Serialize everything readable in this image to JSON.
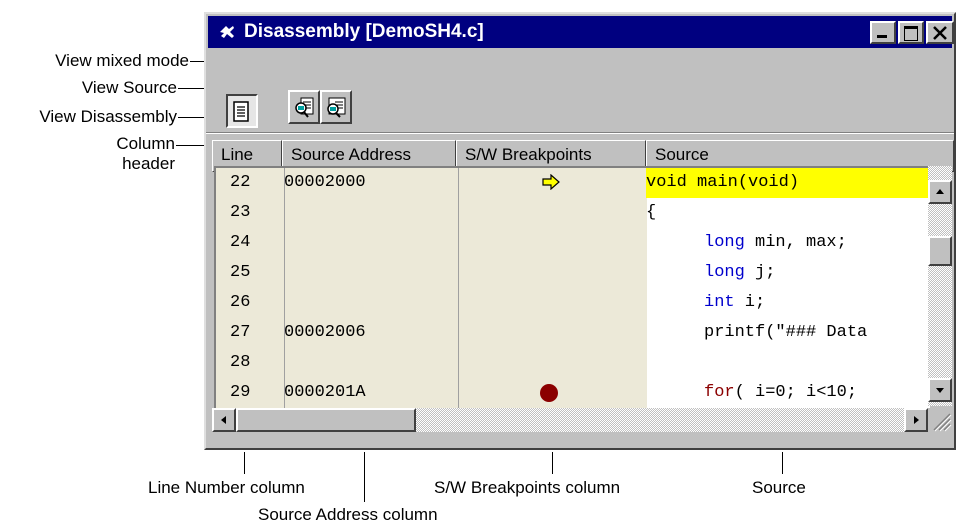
{
  "window": {
    "title": "Disassembly [DemoSH4.c]"
  },
  "toolbar": [
    {
      "name": "view-source-button",
      "icon": "source-document-icon"
    },
    {
      "name": "view-mixed-mode-button",
      "icon": "mixed-mode-icon"
    },
    {
      "name": "view-disassembly-button",
      "icon": "disassembly-icon"
    }
  ],
  "columns": {
    "line": "Line",
    "address": "Source Address",
    "breakpoints": "S/W Breakpoints",
    "source": "Source"
  },
  "rows": [
    {
      "line": "22",
      "address": "00002000",
      "bp": "current-pc-arrow-icon",
      "source_kw": "",
      "source": "void main(void)",
      "highlight": true
    },
    {
      "line": "23",
      "address": "",
      "bp": "",
      "source_kw": "",
      "source": "{",
      "highlight": false
    },
    {
      "line": "24",
      "address": "",
      "bp": "",
      "source_kw": "long",
      "source": " min, max;",
      "highlight": false
    },
    {
      "line": "25",
      "address": "",
      "bp": "",
      "source_kw": "long",
      "source": " j;",
      "highlight": false
    },
    {
      "line": "26",
      "address": "",
      "bp": "",
      "source_kw": "int",
      "source": " i;",
      "highlight": false
    },
    {
      "line": "27",
      "address": "00002006",
      "bp": "",
      "source_kw": "",
      "source": "printf(\"### Data",
      "highlight": false
    },
    {
      "line": "28",
      "address": "",
      "bp": "",
      "source_kw": "",
      "source": "",
      "highlight": false
    },
    {
      "line": "29",
      "address": "0000201A",
      "bp": "breakpoint-icon",
      "source_kw": "for",
      "source": "( i=0; i<10;",
      "highlight": false
    }
  ],
  "callouts": {
    "view_mixed_mode": "View mixed mode",
    "view_source": "View Source",
    "view_disassembly": "View Disassembly",
    "column_header_1": "Column",
    "column_header_2": "header",
    "line_number_column": "Line Number column",
    "source_address_column": "Source Address column",
    "breakpoints_column": "S/W Breakpoints column",
    "source": "Source"
  },
  "colors": {
    "titlebar": "#000080",
    "highlight": "#ffff00",
    "keyword": "#0000cc",
    "breakpoint": "#8b0000",
    "column_bg": "#ece9d8"
  }
}
